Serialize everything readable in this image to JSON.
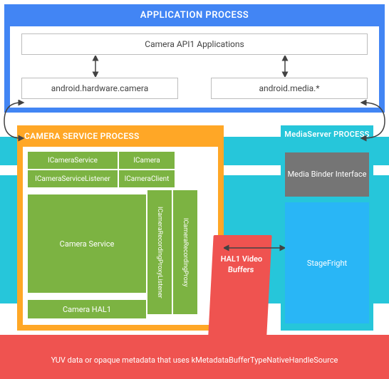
{
  "app_process": {
    "title": "APPLICATION PROCESS",
    "api1": "Camera API1 Applications",
    "hardware": "android.hardware.camera",
    "media": "android.media.*"
  },
  "camera_service": {
    "title": "CAMERA SERVICE PROCESS",
    "icameraservice": "ICameraService",
    "icamera": "ICamera",
    "icameraservicelistener": "ICameraServiceListener",
    "icameraclient": "ICameraClient",
    "main": "Camera Service",
    "recording_proxy_listener": "ICameraRecordingProxyListener",
    "recording_proxy": "ICameraRecordingProxy",
    "hal1": "Camera HAL1"
  },
  "hal_buffers": "HAL1 Video Buffers",
  "mediaserver": {
    "title": "MediaServer PROCESS",
    "binder": "Media Binder Interface",
    "stagefright": "StageFright"
  },
  "footer": "YUV data or opaque metadata that uses kMetadataBufferTypeNativeHandleSource"
}
